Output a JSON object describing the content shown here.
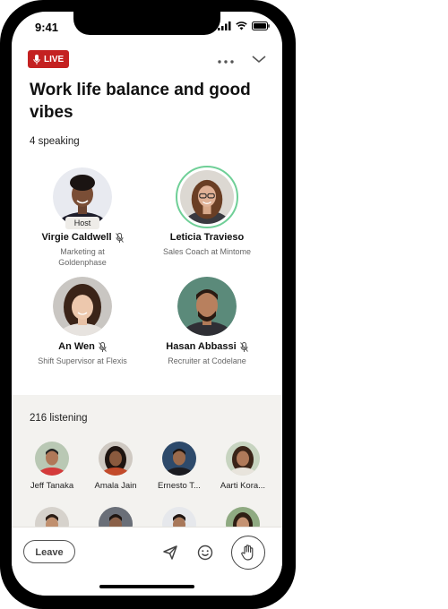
{
  "status_bar": {
    "time": "9:41"
  },
  "header": {
    "live_label": "LIVE"
  },
  "room": {
    "title": "Work life balance and good vibes"
  },
  "speakers_section": {
    "count_label": "4 speaking",
    "host_tag": "Host",
    "speakers": [
      {
        "name": "Virgie Caldwell",
        "role": "Marketing at Goldenphase",
        "muted": true,
        "host": true
      },
      {
        "name": "Leticia Travieso",
        "role": "Sales Coach at Mintome",
        "muted": false,
        "active": true
      },
      {
        "name": "An Wen",
        "role": "Shift Supervisor at Flexis",
        "muted": true
      },
      {
        "name": "Hasan Abbassi",
        "role": "Recruiter at Codelane",
        "muted": true
      }
    ]
  },
  "listeners_section": {
    "count_label": "216 listening",
    "listeners": [
      {
        "name": "Jeff Tanaka"
      },
      {
        "name": "Amala Jain"
      },
      {
        "name": "Ernesto T..."
      },
      {
        "name": "Aarti Kora..."
      }
    ]
  },
  "bottom_bar": {
    "leave_label": "Leave"
  },
  "colors": {
    "live_red": "#c42121",
    "active_ring": "#6fcf97",
    "listening_bg": "#f3f2ef"
  },
  "icons": [
    "mic-icon",
    "more-icon",
    "chevron-down-icon",
    "mic-off-icon",
    "send-icon",
    "emoji-icon",
    "raise-hand-icon",
    "signal-icon",
    "wifi-icon",
    "battery-icon"
  ]
}
